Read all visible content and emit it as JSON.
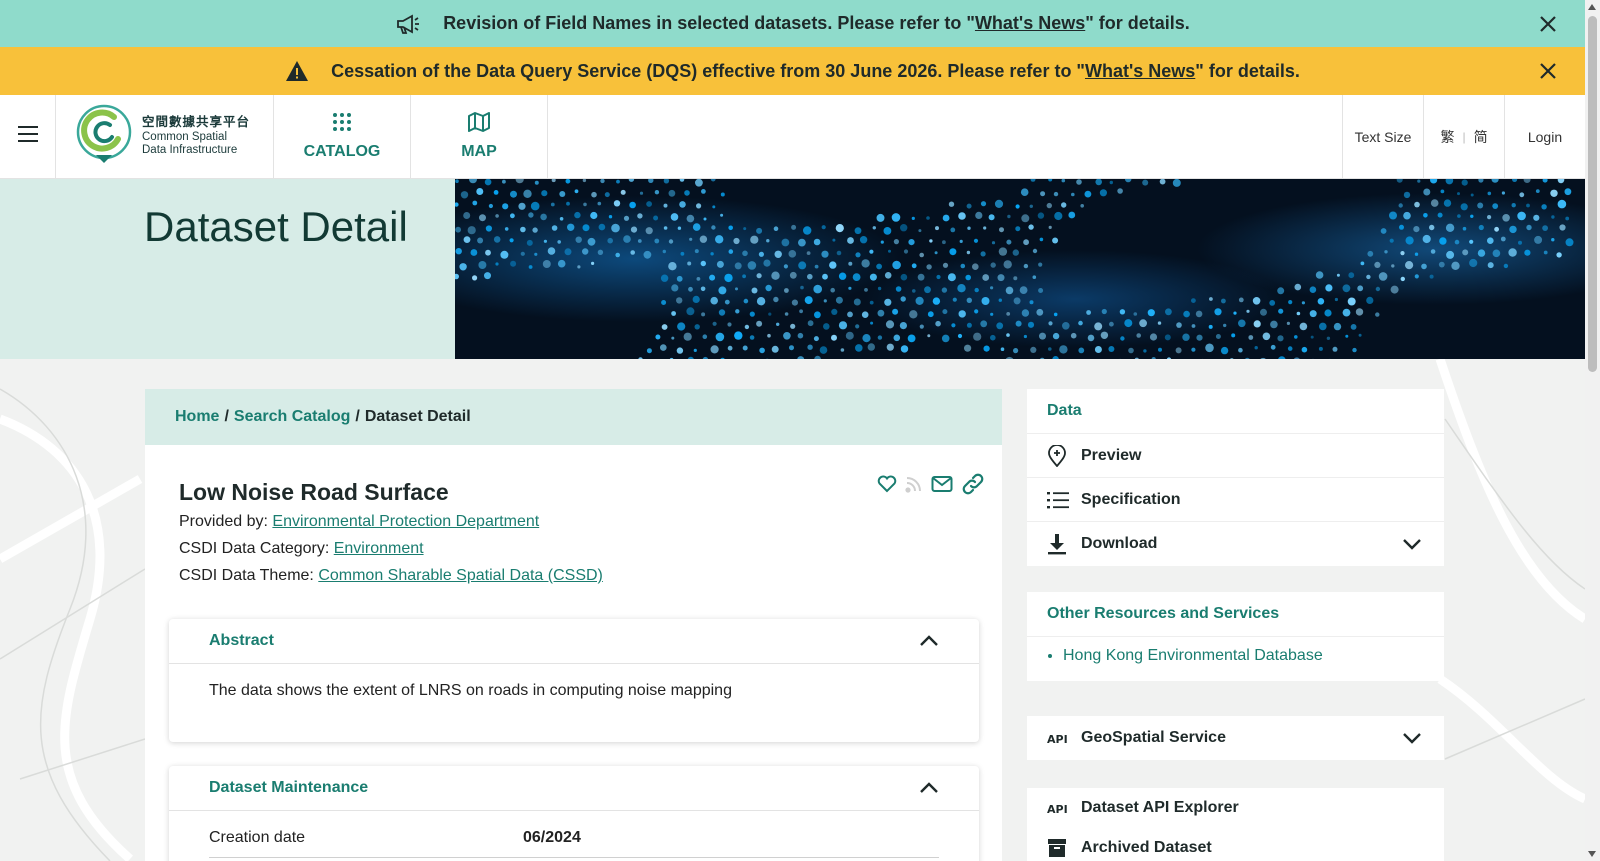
{
  "banners": [
    {
      "text_before": "Revision of Field Names in selected datasets. Please refer to \"",
      "link": "What's News",
      "text_after": "\" for details.",
      "color": "#8fdbcb"
    },
    {
      "text_before": "Cessation of the Data Query Service (DQS) effective from 30 June 2026. Please refer to \"",
      "link": "What's News",
      "text_after": "\" for details.",
      "color": "#f8c13a"
    }
  ],
  "header": {
    "logo_cn": "空間數據共享平台",
    "logo_en_1": "Common Spatial",
    "logo_en_2": "Data Infrastructure",
    "nav": [
      {
        "label": "CATALOG",
        "icon": "grid-icon"
      },
      {
        "label": "MAP",
        "icon": "map-icon"
      }
    ],
    "text_size": "Text Size",
    "lang_trad": "繁",
    "lang_simp": "简",
    "login": "Login"
  },
  "hero": {
    "title": "Dataset Detail"
  },
  "breadcrumb": {
    "home": "Home",
    "sep": "/",
    "catalog": "Search Catalog",
    "current": "Dataset Detail"
  },
  "dataset": {
    "title": "Low Noise Road Surface",
    "provided_label": "Provided by: ",
    "provider": "Environmental Protection Department",
    "category_label": "CSDI Data Category: ",
    "category": "Environment",
    "theme_label": "CSDI Data Theme: ",
    "theme": "Common Sharable Spatial Data (CSSD)"
  },
  "abstract": {
    "title": "Abstract",
    "text": "The data shows the extent of LNRS on roads in computing noise mapping"
  },
  "maintenance": {
    "title": "Dataset Maintenance",
    "rows": [
      {
        "key": "Creation date",
        "value": "06/2024"
      }
    ]
  },
  "side_data": {
    "title": "Data",
    "items": [
      {
        "label": "Preview",
        "icon": "map-pin-icon"
      },
      {
        "label": "Specification",
        "icon": "list-icon"
      },
      {
        "label": "Download",
        "icon": "download-icon"
      }
    ]
  },
  "side_resources": {
    "title": "Other Resources and Services",
    "items": [
      "Hong Kong Environmental Database"
    ]
  },
  "side_services": {
    "geospatial": "GeoSpatial Service",
    "api_explorer": "Dataset API Explorer",
    "archived": "Archived Dataset"
  },
  "colors": {
    "accent": "#1a7d70",
    "banner_teal": "#8fdbcb",
    "banner_yellow": "#f8c13a",
    "hero_bg": "#d7ece7"
  }
}
